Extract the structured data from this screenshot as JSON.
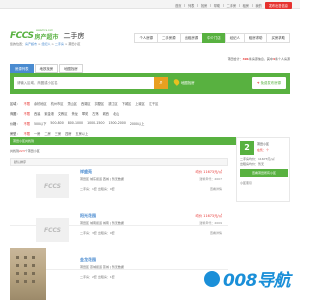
{
  "topbar": {
    "links": [
      "首页",
      "列表",
      "找房",
      "帮助",
      "二手房",
      "租房",
      "我的"
    ],
    "post_label": "发布出售信息"
  },
  "header": {
    "logo_letters": "FCCS",
    "logo_cn": "房产超市",
    "logo_site": "www.fccs.com",
    "section_title": "二手房"
  },
  "breadcrumb": {
    "prefix": "您的位置：",
    "items": [
      "房产超市",
      "经纪人",
      "二手房",
      "莆田小区"
    ]
  },
  "navtabs": [
    "个人房源",
    "二手房源",
    "出租房源",
    "中介门店",
    "经纪人",
    "租房求助",
    "买房求助"
  ],
  "navtab_active_index": 3,
  "agent_info": {
    "prefix": "莆田合计：",
    "count": "491",
    "middle": "条房源信息，其中",
    "count2": "4",
    "suffix": "条个人房源"
  },
  "subtabs": [
    "房源列表",
    "地铁找房",
    "地图找房"
  ],
  "subtab_active_index": 0,
  "search": {
    "placeholder": "请输入区域、商圈或小区名",
    "button_icon": "search-icon",
    "map_label": "地图找房",
    "post_prefix": "",
    "post_label": "免费发布房源"
  },
  "filters": [
    {
      "key": "区域：",
      "values": [
        "不限",
        "余杭地区",
        "杭州市区",
        "萧山区",
        "西湖区",
        "拱墅区",
        "滨江区",
        "下城区",
        "上城区",
        "江干区"
      ],
      "selected": 0
    },
    {
      "key": "商圈：",
      "values": [
        "不限",
        "西溪",
        "紫金港",
        "文教区",
        "黄龙",
        "翠苑",
        "古荡",
        "城西",
        "北山"
      ],
      "selected": 0
    },
    {
      "key": "价格：",
      "values": [
        "不限",
        "500以下",
        "500-800",
        "800-1000",
        "1000-1500",
        "1500-2000",
        "2000以上"
      ],
      "selected": 0
    },
    {
      "key": "房型：",
      "values": [
        "不限",
        "一房",
        "二房",
        "三房",
        "四房",
        "五房以上"
      ],
      "selected": 0
    }
  ],
  "section": {
    "label": "莆田小区共找到",
    "count_prefix": "共找到",
    "count": "223",
    "count_suffix": "个莆田小区",
    "sort_label": "默认排序"
  },
  "listings": [
    {
      "title": "祥盛苑",
      "address": "莆田区 城东街道 西城 | 暂无数据",
      "meta": "二手房：1套  出租房：0套",
      "price": "均价 11673元/㎡",
      "unit": "建筑年代：2007",
      "cta": "查看详情"
    },
    {
      "title": "阳光花园",
      "address": "莆田区 城南街道 城南 | 暂无数据",
      "meta": "二手房：3套  出租房：0套",
      "price": "均价 11673元/㎡",
      "unit": "建筑年代：2009",
      "cta": "查看详情"
    },
    {
      "title": "金龙花园",
      "address": "莆田区 荔城街道 荔城 | 暂无数据",
      "meta": "二手房：2套  出租房：1套",
      "price": "均价 11673元/㎡",
      "unit": "建筑年代：2011",
      "cta": "查看详情"
    }
  ],
  "sidebar": {
    "badge": "2",
    "line1": "莆田小区",
    "line2": "在售：个",
    "row1": "二手房均价：11673元/㎡",
    "row2": "出租房均价：暂无",
    "button": "查看莆田所有小区",
    "index": "小区索引"
  },
  "watermark": "008导航",
  "colors": {
    "brand_green": "#58b140",
    "accent_red": "#e6312e",
    "link_blue": "#4a8bd0",
    "orange": "#e8a020"
  }
}
